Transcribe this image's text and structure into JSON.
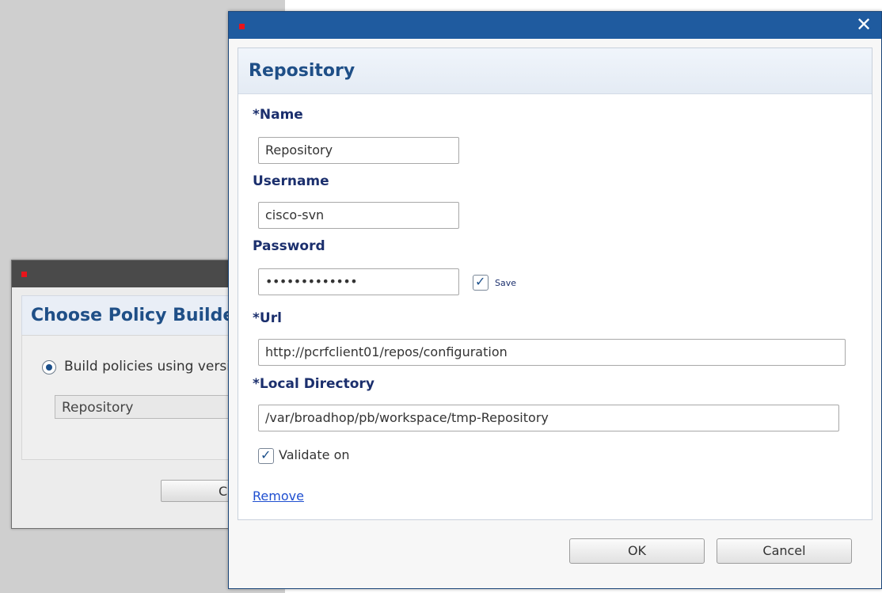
{
  "background_dialog": {
    "title": "Choose Policy Builder",
    "radio_label": "Build policies using version controlled data",
    "select_value": "Repository",
    "button_label": "C"
  },
  "dialog": {
    "header_title": "Repository",
    "fields": {
      "name_label": "*Name",
      "name_value": "Repository",
      "username_label": "Username",
      "username_value": "cisco-svn",
      "password_label": "Password",
      "password_value": "•••••••••••••",
      "save_label": "Save",
      "url_label": "*Url",
      "url_value": "http://pcrfclient01/repos/configuration",
      "local_dir_label": "*Local Directory",
      "local_dir_value": "/var/broadhop/pb/workspace/tmp-Repository",
      "validate_label": "Validate on"
    },
    "remove_link": "Remove",
    "ok_label": "OK",
    "cancel_label": "Cancel",
    "close_icon": "close-icon",
    "accent_color": "#1f5b9f",
    "title_color": "#1f4f87"
  }
}
